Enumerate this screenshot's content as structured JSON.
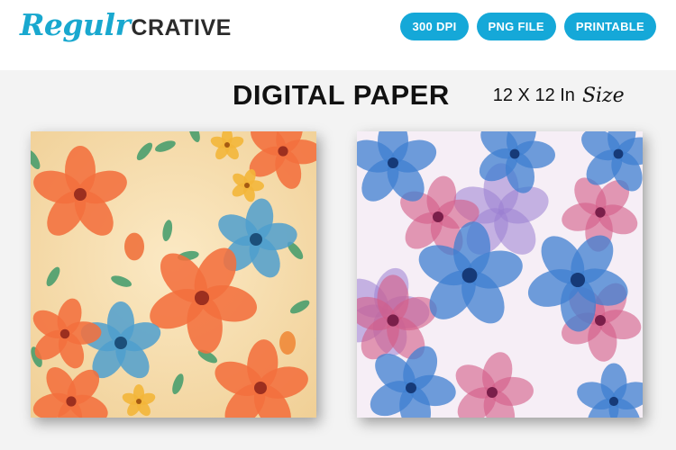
{
  "brand": {
    "script": "Regulr",
    "bold": "CRATIVE"
  },
  "badges": [
    "300 DPI",
    "PNG FILE",
    "PRINTABLE"
  ],
  "headline": {
    "title": "DIGITAL PAPER",
    "size": "12 X 12 In",
    "size_word": "Size"
  },
  "colors": {
    "accent": "#15a8d8",
    "logo_script": "#19a8cf",
    "text": "#111111"
  }
}
